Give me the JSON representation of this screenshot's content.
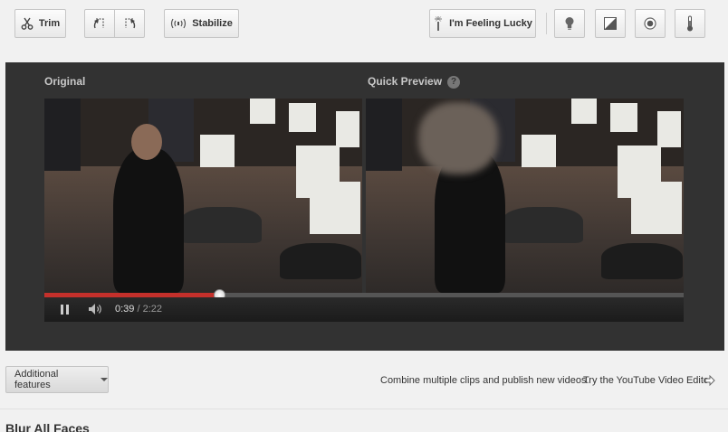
{
  "toolbar": {
    "trim_label": "Trim",
    "stabilize_label": "Stabilize",
    "lucky_label": "I'm Feeling Lucky",
    "icons": [
      "scissors-icon",
      "rotate-left-icon",
      "rotate-right-icon",
      "stabilize-icon",
      "magic-wand-icon",
      "lightbulb-icon",
      "contrast-icon",
      "color-icon",
      "thermometer-icon"
    ]
  },
  "preview": {
    "original_label": "Original",
    "quick_preview_label": "Quick Preview",
    "help_glyph": "?"
  },
  "player": {
    "current_time": "0:39",
    "separator": " / ",
    "duration": "2:22",
    "progress_fraction": 0.274
  },
  "bottom": {
    "additional_features_label": "Additional features",
    "combine_text": "Combine multiple clips and publish new videos.",
    "try_link": "Try the YouTube Video Editor",
    "blur_title": "Blur All Faces"
  },
  "colors": {
    "accent_progress": "#c4302b",
    "panel_bg": "#323232"
  }
}
